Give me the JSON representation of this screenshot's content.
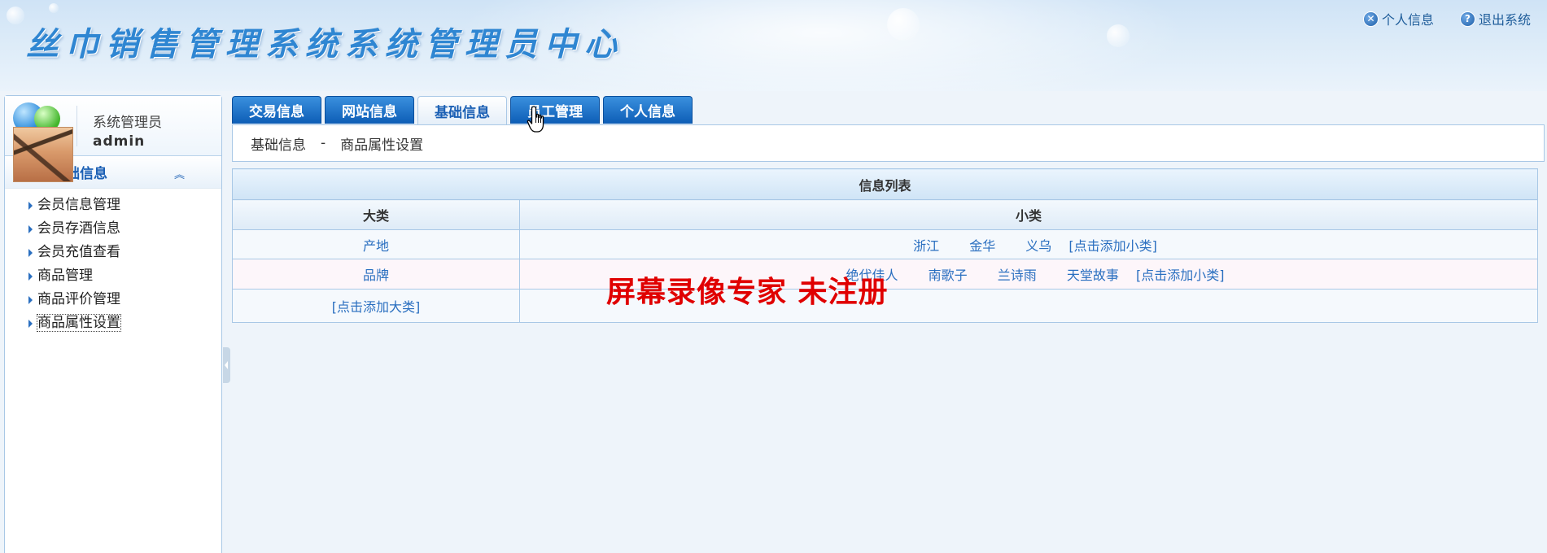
{
  "header": {
    "title": "丝巾销售管理系统系统管理员中心",
    "links": [
      {
        "label": "个人信息",
        "icon": "close-circle-icon"
      },
      {
        "label": "退出系统",
        "icon": "help-circle-icon"
      }
    ]
  },
  "sidebar": {
    "user": {
      "role": "系统管理员",
      "name": "admin"
    },
    "section_title": "基础信息",
    "items": [
      {
        "label": "会员信息管理"
      },
      {
        "label": "会员存酒信息"
      },
      {
        "label": "会员充值查看"
      },
      {
        "label": "商品管理"
      },
      {
        "label": "商品评价管理"
      },
      {
        "label": "商品属性设置"
      }
    ]
  },
  "tabs": [
    {
      "label": "交易信息",
      "active": false
    },
    {
      "label": "网站信息",
      "active": false
    },
    {
      "label": "基础信息",
      "active": true
    },
    {
      "label": "员工管理",
      "active": false
    },
    {
      "label": "个人信息",
      "active": false
    }
  ],
  "breadcrumb": {
    "section": "基础信息",
    "separator": "-",
    "page": "商品属性设置"
  },
  "table": {
    "caption": "信息列表",
    "headers": [
      "大类",
      "小类"
    ],
    "rows": [
      {
        "category": "产地",
        "subs": [
          "浙江",
          "金华",
          "义乌"
        ],
        "add_sub": "[点击添加小类]"
      },
      {
        "category": "品牌",
        "subs": [
          "绝代佳人",
          "南歌子",
          "兰诗雨",
          "天堂故事"
        ],
        "add_sub": "[点击添加小类]"
      }
    ],
    "add_category": "[点击添加大类]"
  },
  "watermark": "屏幕录像专家 未注册",
  "colors": {
    "accent": "#1a5fb4",
    "tab": "#0d5db6",
    "link": "#2a6fc0",
    "watermark": "#e00000"
  }
}
